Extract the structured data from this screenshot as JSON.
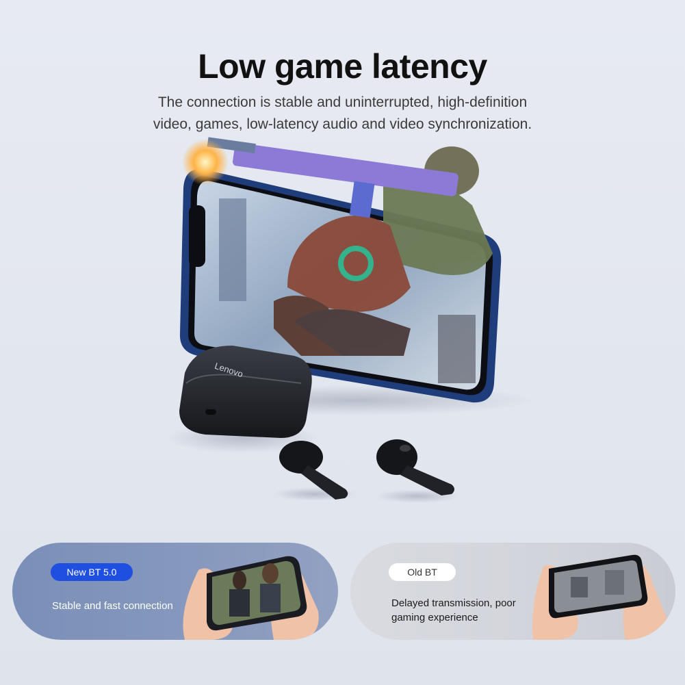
{
  "hero": {
    "title": "Low game latency",
    "subtitle_line1": "The connection is stable and uninterrupted, high-definition",
    "subtitle_line2": "video, games, low-latency audio and video synchronization.",
    "brand": "Lenovo"
  },
  "comparison": {
    "new": {
      "badge": "New  BT 5.0",
      "description": "Stable and fast connection",
      "badge_color": "#1f4fe0"
    },
    "old": {
      "badge": "Old BT",
      "description_line1": "Delayed transmission, poor",
      "description_line2": "gaming experience"
    }
  },
  "icons": [
    "phone-icon",
    "earbuds-case-icon",
    "earbud-icon",
    "hands-holding-phone-icon"
  ]
}
